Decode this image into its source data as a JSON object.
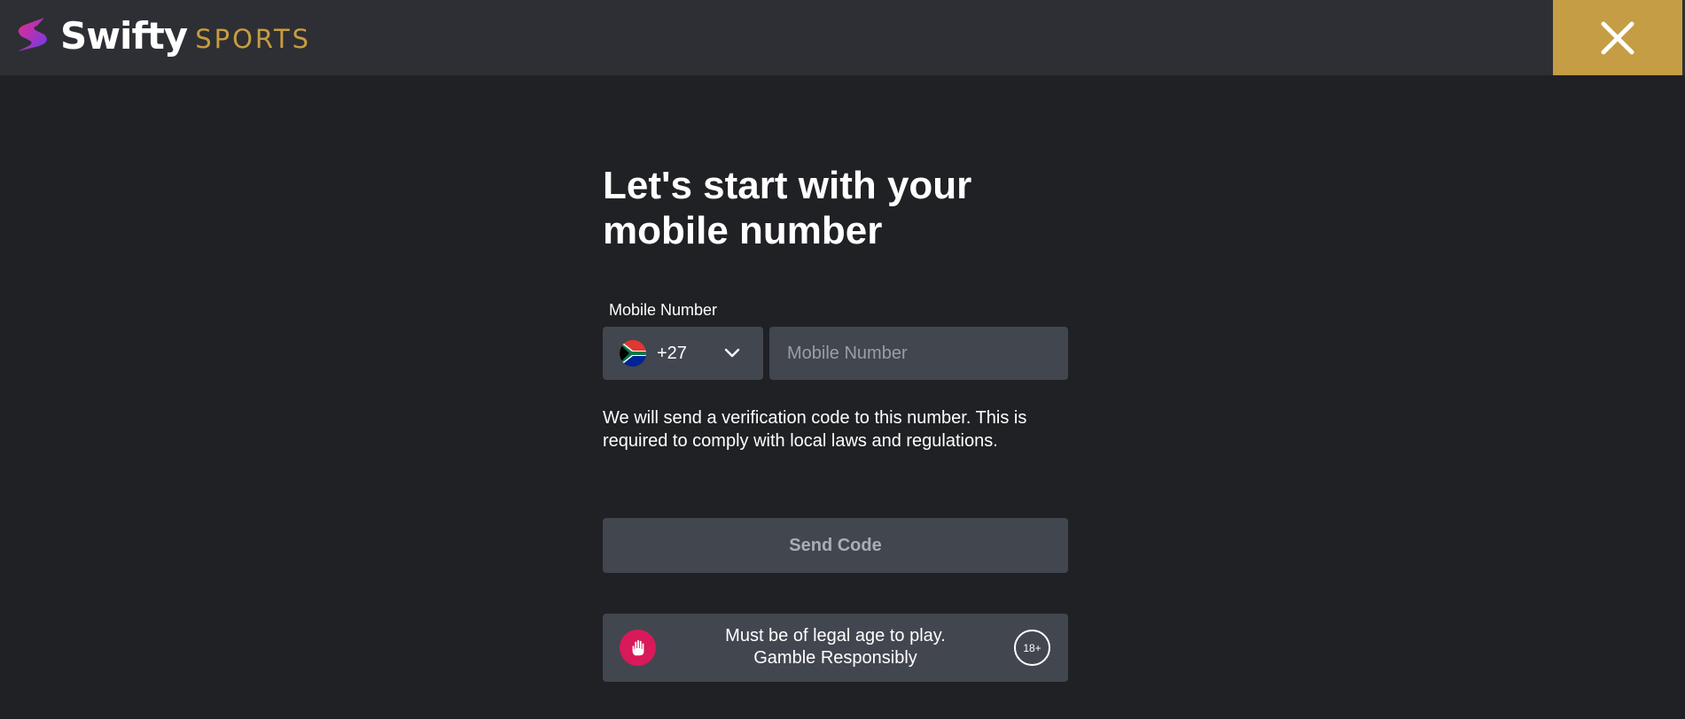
{
  "brand": {
    "name": "Swifty",
    "sub": "SPORTS",
    "accent": "#c59d44"
  },
  "header": {
    "close_icon": "close-icon"
  },
  "main": {
    "title": "Let's start with your mobile number",
    "mobile_label": "Mobile Number",
    "country": {
      "flag_icon": "south-africa-flag-icon",
      "dial_code": "+27",
      "chevron_icon": "chevron-down-icon"
    },
    "mobile_placeholder": "Mobile Number",
    "info": "We will send a verification code to this number. This is required to comply with local laws and regulations.",
    "send_button": "Send Code"
  },
  "age_notice": {
    "icon": "hand-stop-icon",
    "line1": "Must be of legal age to play.",
    "line2": "Gamble Responsibly",
    "badge": "18+"
  }
}
